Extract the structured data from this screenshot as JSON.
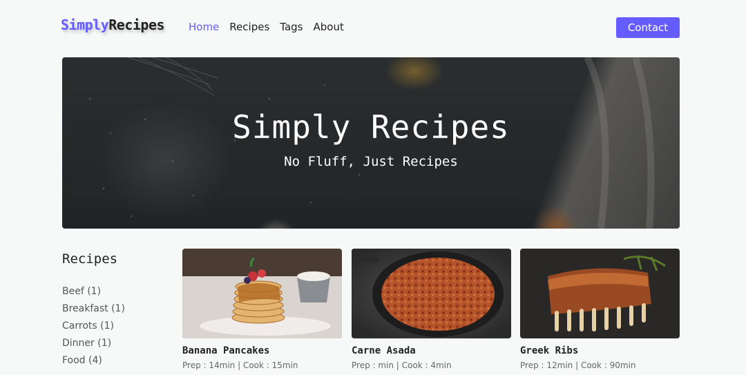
{
  "brand": {
    "part1": "Simply",
    "part2": "Recipes"
  },
  "nav": {
    "links": [
      "Home",
      "Recipes",
      "Tags",
      "About"
    ],
    "active": 0,
    "cta": "Contact"
  },
  "hero": {
    "title": "Simply Recipes",
    "subtitle": "No Fluff, Just Recipes"
  },
  "sidebar": {
    "title": "Recipes",
    "tags": [
      "Beef (1)",
      "Breakfast (1)",
      "Carrots (1)",
      "Dinner (1)",
      "Food (4)"
    ]
  },
  "recipes": [
    {
      "name": "Banana Pancakes",
      "meta": "Prep : 14min | Cook : 15min"
    },
    {
      "name": "Carne Asada",
      "meta": "Prep : min | Cook : 4min"
    },
    {
      "name": "Greek Ribs",
      "meta": "Prep : 12min | Cook : 90min"
    }
  ],
  "colors": {
    "accent": "#645cff",
    "background": "#f7f8f8"
  }
}
